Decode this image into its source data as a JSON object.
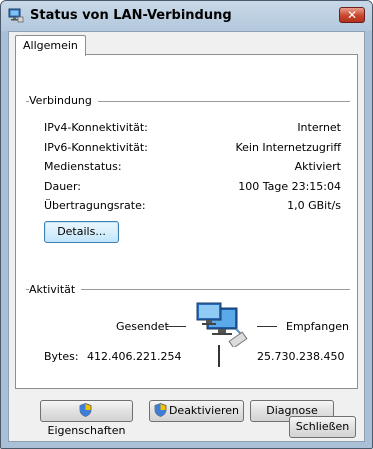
{
  "window": {
    "title": "Status von LAN-Verbindung",
    "close_label": "✕"
  },
  "tab": {
    "label": "Allgemein"
  },
  "verbindung": {
    "heading": "Verbindung",
    "rows": [
      {
        "label": "IPv4-Konnektivität:",
        "value": "Internet"
      },
      {
        "label": "IPv6-Konnektivität:",
        "value": "Kein Internetzugriff"
      },
      {
        "label": "Medienstatus:",
        "value": "Aktiviert"
      },
      {
        "label": "Dauer:",
        "value": "100 Tage 23:15:04"
      },
      {
        "label": "Übertragungsrate:",
        "value": "1,0 GBit/s"
      }
    ],
    "details_button": "Details..."
  },
  "aktivitaet": {
    "heading": "Aktivität",
    "sent_label": "Gesendet",
    "received_label": "Empfangen",
    "bytes_label": "Bytes:",
    "bytes_sent": "412.406.221.254",
    "bytes_received": "25.730.238.450"
  },
  "buttons": {
    "properties": "Eigenschaften",
    "deactivate": "Deaktivieren",
    "diagnose": "Diagnose",
    "close": "Schließen"
  },
  "icons": {
    "title": "network-connection-icon",
    "activity": "network-activity-icon",
    "shield": "uac-shield-icon"
  }
}
